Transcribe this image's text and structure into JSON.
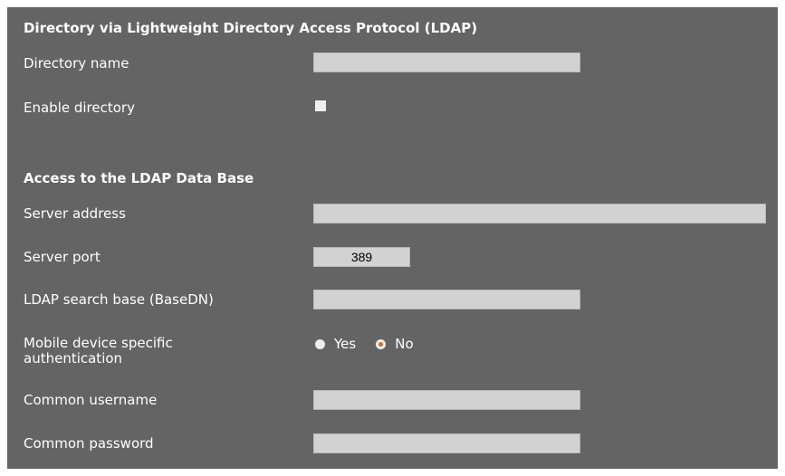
{
  "section_ldap": {
    "title": "Directory via Lightweight Directory Access Protocol (LDAP)",
    "directory_name_label": "Directory name",
    "directory_name_value": "",
    "enable_directory_label": "Enable directory",
    "enable_directory_checked": false
  },
  "section_access": {
    "title": "Access to the LDAP Data Base",
    "server_address_label": "Server address",
    "server_address_value": "",
    "server_port_label": "Server port",
    "server_port_value": "389",
    "search_base_label": "LDAP search base (BaseDN)",
    "search_base_value": "",
    "mobile_auth_label_line1": "Mobile device specific",
    "mobile_auth_label_line2": "authentication",
    "mobile_auth_options": [
      "Yes",
      "No"
    ],
    "mobile_auth_selected": "No",
    "common_username_label": "Common username",
    "common_username_value": "",
    "common_password_label": "Common password",
    "common_password_value": ""
  },
  "colors": {
    "panel_bg": "#646464",
    "field_bg": "#d2d2d2",
    "radio_selected_dot": "#e06a1f"
  }
}
